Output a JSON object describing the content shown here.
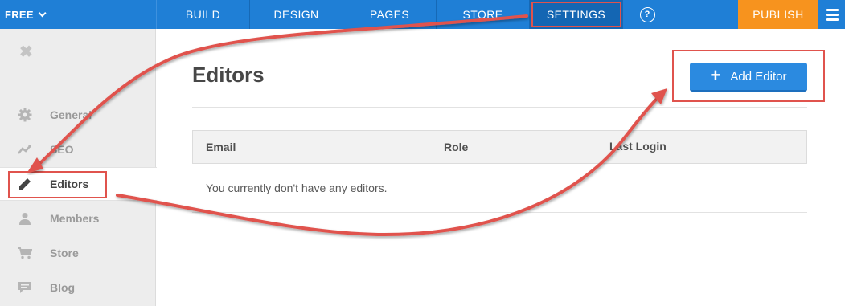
{
  "topbar": {
    "plan_label": "FREE",
    "tabs": [
      "BUILD",
      "DESIGN",
      "PAGES",
      "STORE",
      "SETTINGS"
    ],
    "help_label": "?",
    "publish_label": "PUBLISH"
  },
  "sidebar": {
    "close_label": "✖",
    "items": [
      {
        "label": "General",
        "icon": "gear-icon"
      },
      {
        "label": "SEO",
        "icon": "trend-icon"
      },
      {
        "label": "Editors",
        "icon": "pencil-icon"
      },
      {
        "label": "Members",
        "icon": "person-icon"
      },
      {
        "label": "Store",
        "icon": "cart-icon"
      },
      {
        "label": "Blog",
        "icon": "comment-icon"
      }
    ]
  },
  "main": {
    "title": "Editors",
    "add_button_plus": "+",
    "add_button_label": "Add Editor",
    "columns": [
      "Email",
      "Role",
      "Last Login"
    ],
    "empty_message": "You currently don't have any editors."
  },
  "colors": {
    "topbar": "#1f7fd6",
    "publish": "#f7931e",
    "button": "#2b8ae0",
    "annotation": "#e0534d"
  }
}
